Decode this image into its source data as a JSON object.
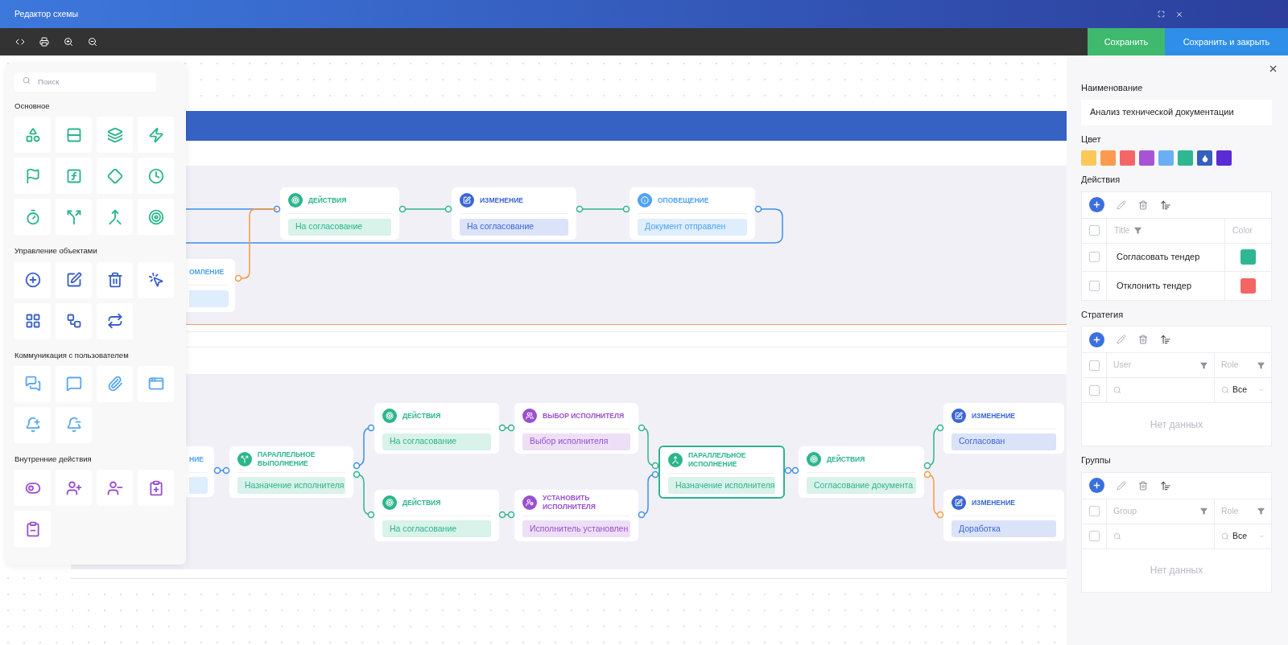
{
  "window": {
    "title": "Редактор схемы"
  },
  "toolbar": {
    "tools": [
      {
        "kind": "code"
      },
      {
        "kind": "print"
      },
      {
        "kind": "zoom_in"
      },
      {
        "kind": "zoom_out"
      }
    ],
    "buttons": [
      {
        "kind": "save",
        "label": "Сохранить"
      },
      {
        "kind": "save_close",
        "label": "Сохранить и закрыть"
      }
    ]
  },
  "palette": {
    "search": {
      "placeholder": "Поиск"
    },
    "sections": [
      {
        "title": "Основное",
        "kind": "basic",
        "tools": [
          {
            "kind": "shapes"
          },
          {
            "kind": "rows"
          },
          {
            "kind": "layers"
          },
          {
            "kind": "bolt"
          },
          {
            "kind": "flag"
          },
          {
            "kind": "function"
          },
          {
            "kind": "function_diamond"
          },
          {
            "kind": "clock"
          },
          {
            "kind": "timer_diamond"
          },
          {
            "kind": "split"
          },
          {
            "kind": "merge"
          },
          {
            "kind": "target"
          }
        ]
      },
      {
        "title": "Управление объектами",
        "kind": "objects",
        "tools": [
          {
            "kind": "add"
          },
          {
            "kind": "edit"
          },
          {
            "kind": "delete"
          },
          {
            "kind": "pointer"
          },
          {
            "kind": "grid_add"
          },
          {
            "kind": "workflow"
          },
          {
            "kind": "repeat"
          }
        ]
      },
      {
        "title": "Коммуникация с пользователем",
        "kind": "communication",
        "tools": [
          {
            "kind": "messages"
          },
          {
            "kind": "message"
          },
          {
            "kind": "attachment"
          },
          {
            "kind": "alert"
          },
          {
            "kind": "bell_add"
          },
          {
            "kind": "bell_remove"
          }
        ]
      },
      {
        "title": "Внутренние действия",
        "kind": "internal",
        "tools": [
          {
            "kind": "toggle"
          },
          {
            "kind": "user_add"
          },
          {
            "kind": "user_remove"
          },
          {
            "kind": "clipboard_add"
          },
          {
            "kind": "clipboard_remove"
          }
        ]
      }
    ]
  },
  "nodes": [
    {
      "kind": "action",
      "title": "ДЕЙСТВИЯ",
      "label": "На согласование",
      "color": "#2bb58a",
      "selected": false,
      "cut_off": false
    },
    {
      "kind": "change",
      "title": "ИЗМЕНЕНИЕ",
      "label": "На согласование",
      "color": "#3a66d6",
      "selected": false,
      "cut_off": false
    },
    {
      "kind": "notify",
      "title": "ОПОВЕЩЕНИЕ",
      "label": "Документ отправлен",
      "color": "#4ea2f2",
      "selected": false,
      "cut_off": false
    },
    {
      "kind": "notify",
      "title": "ОМЛЕНИЕ",
      "color": "#4ea2f2",
      "selected": false,
      "cut_off": true
    },
    {
      "kind": "notify",
      "title": "НИЕ",
      "color": "#4ea2f2",
      "selected": false,
      "cut_off": true
    },
    {
      "kind": "parallel",
      "title": "ПАРАЛЛЕЛЬНОЕ ВЫПОЛНЕНИЕ",
      "label": "Назначение исполнителя",
      "color": "#2bb58a",
      "selected": false,
      "cut_off": false
    },
    {
      "kind": "action",
      "title": "ДЕЙСТВИЯ",
      "label": "На согласование",
      "color": "#2bb58a",
      "selected": false,
      "cut_off": false
    },
    {
      "kind": "action",
      "title": "ДЕЙСТВИЯ",
      "label": "На согласование",
      "color": "#2bb58a",
      "selected": false,
      "cut_off": false
    },
    {
      "kind": "choose",
      "title": "ВЫБОР ИСПОЛНИТЕЛЯ",
      "label": "Выбор исполнителя",
      "color": "#9a4fcf",
      "selected": false,
      "cut_off": false
    },
    {
      "kind": "assign",
      "title": "УСТАНОВИТЬ ИСПОЛНИТЕЛЯ",
      "label": "Исполнитель установлен",
      "color": "#9a4fcf",
      "selected": false,
      "cut_off": false
    },
    {
      "kind": "join",
      "title": "ПАРАЛЛЕЛЬНОЕ ИСПОЛНЕНИЕ",
      "label": "Назначение исполнителя",
      "color": "#2bb58a",
      "selected": true,
      "cut_off": false
    },
    {
      "kind": "action",
      "title": "ДЕЙСТВИЯ",
      "label": "Согласование документа",
      "color": "#2bb58a",
      "selected": false,
      "cut_off": false
    },
    {
      "kind": "change",
      "title": "ИЗМЕНЕНИЕ",
      "label": "Согласован",
      "color": "#3a66d6",
      "selected": false,
      "cut_off": false
    },
    {
      "kind": "change",
      "title": "ИЗМЕНЕНИЕ",
      "label": "Доработка",
      "color": "#3a66d6",
      "selected": false,
      "cut_off": false
    }
  ],
  "properties": {
    "name": {
      "label": "Наименование",
      "value": "Анализ технической документации"
    },
    "color": {
      "label": "Цвет",
      "swatches": [
        {
          "color": "#fdc75a",
          "selected": false
        },
        {
          "color": "#fd9a4f",
          "selected": false
        },
        {
          "color": "#f46565",
          "selected": false
        },
        {
          "color": "#a653d6",
          "selected": false
        },
        {
          "color": "#6aaff5",
          "selected": false
        },
        {
          "color": "#2db891",
          "selected": false
        },
        {
          "color": "#3560c0",
          "selected": true
        },
        {
          "color": "#5b2bd6",
          "selected": false
        }
      ]
    },
    "actions": {
      "label": "Действия",
      "header_checked": false,
      "columns": [
        {
          "label": "Title",
          "filter": true
        },
        {
          "label": "Color",
          "filter": false
        }
      ],
      "rows": [
        {
          "title": "Согласовать тендер",
          "checked": false,
          "color": "#2db891"
        },
        {
          "title": "Отклонить тендер",
          "checked": false,
          "color": "#f46565"
        }
      ]
    },
    "strategy": {
      "label": "Стратегия",
      "header_checked": false,
      "filter_checked": false,
      "columns": [
        {
          "label": "User",
          "filter": true
        },
        {
          "label": "Role",
          "filter": true
        }
      ],
      "role_filter": "Все",
      "empty": "Нет данных"
    },
    "groups": {
      "label": "Группы",
      "header_checked": false,
      "filter_checked": false,
      "columns": [
        {
          "label": "Group",
          "filter": true
        },
        {
          "label": "Role",
          "filter": true
        }
      ],
      "role_filter": "Все",
      "empty": "Нет данных"
    }
  }
}
